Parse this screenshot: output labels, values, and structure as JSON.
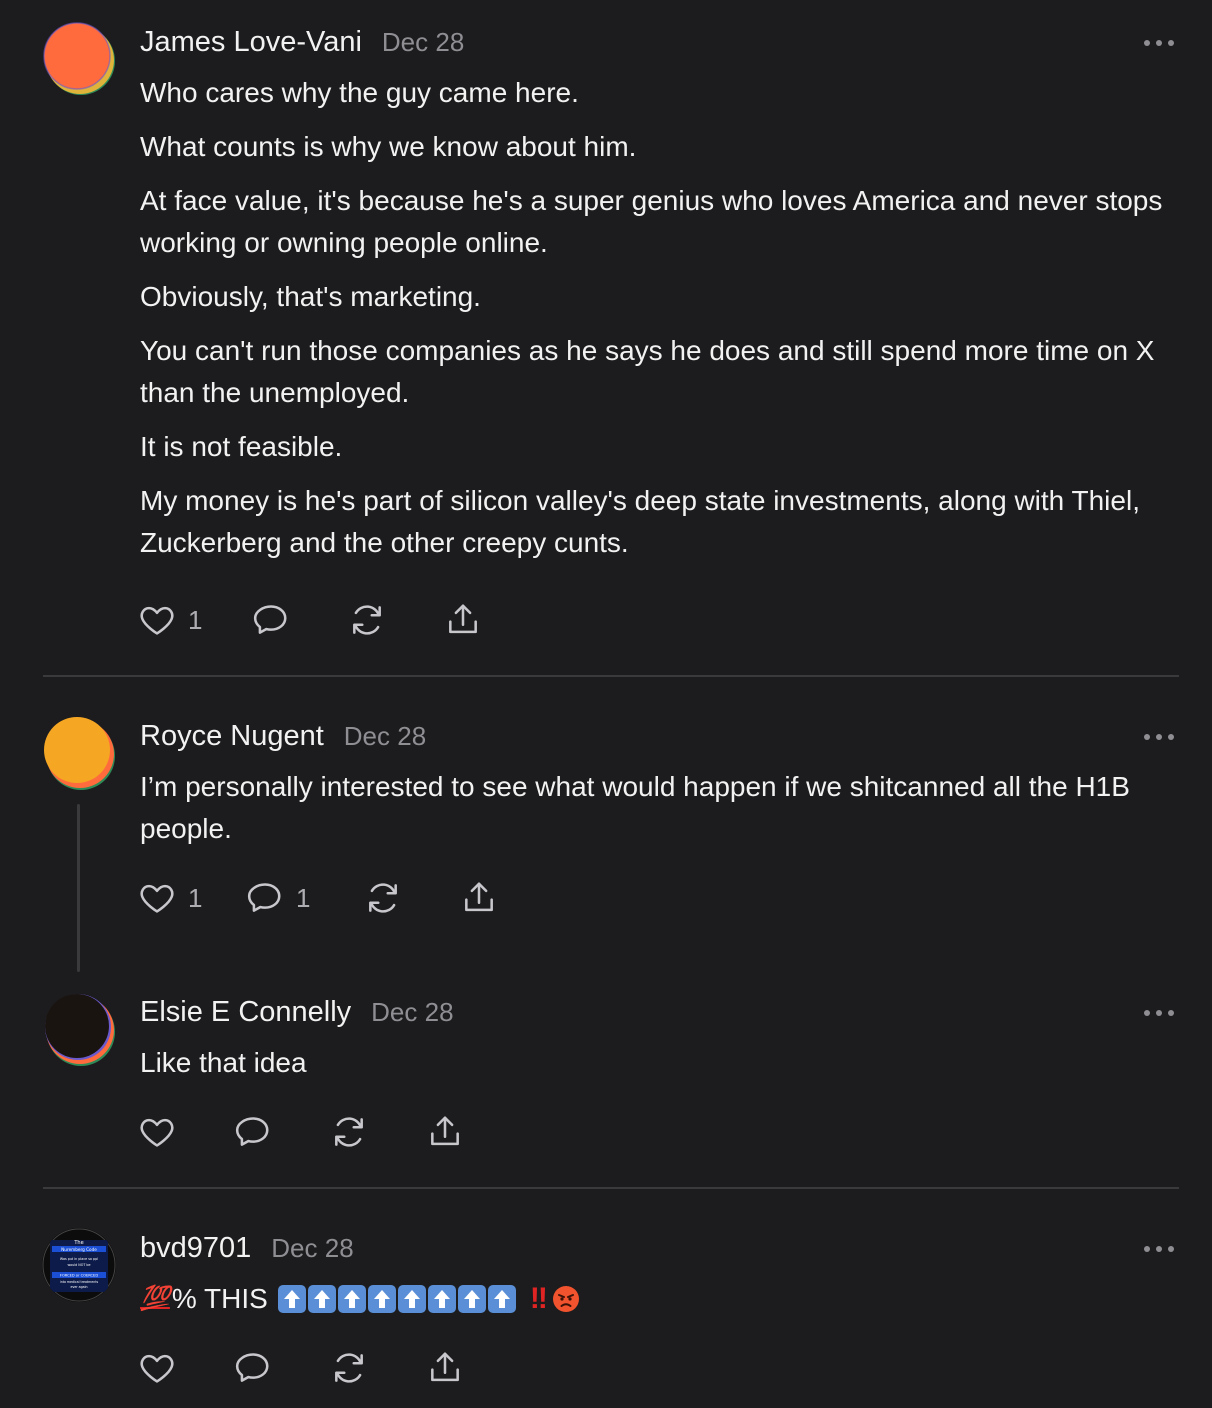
{
  "comments": [
    {
      "author": "James Love-Vani",
      "date": "Dec 28",
      "paragraphs": [
        "Who cares why the guy came here.",
        "What counts is why we know about him.",
        "At face value, it's because he's a super genius who loves America and never stops working or owning people online.",
        "Obviously, that's marketing.",
        "You can't run those companies as he says he does and still spend more time on X than the unemployed.",
        "It is not feasible.",
        "My money is he's part of silicon valley's deep state investments, along with Thiel, Zuckerberg and the other creepy cunts."
      ],
      "likes": "1",
      "replies": ""
    },
    {
      "author": "Royce Nugent",
      "date": "Dec 28",
      "paragraphs": [
        "I’m personally interested to see what would happen if we shitcanned all the H1B people."
      ],
      "likes": "1",
      "replies": "1"
    },
    {
      "author": "Elsie E Connelly",
      "date": "Dec 28",
      "paragraphs": [
        "Like that idea"
      ],
      "likes": "",
      "replies": ""
    },
    {
      "author": "bvd9701",
      "date": "Dec 28",
      "text_prefix": "💯",
      "text_main": "% THIS",
      "bang": "!!",
      "avatar_text": [
        "The",
        "Nuremberg Code",
        "Was put in place so ppl",
        "would NOT be",
        "FORCED or COERCED",
        "into medical treatments",
        "ever again"
      ],
      "likes": "",
      "replies": ""
    }
  ],
  "icons": {
    "like": "heart-icon",
    "reply": "comment-bubble-icon",
    "restack": "restack-arrows-icon",
    "share": "share-upload-icon",
    "more": "more-dots-icon"
  },
  "colors": {
    "background": "#1c1c1e",
    "text": "#f2f2f2",
    "muted": "#8e8e93",
    "divider": "#3a3a3c"
  }
}
